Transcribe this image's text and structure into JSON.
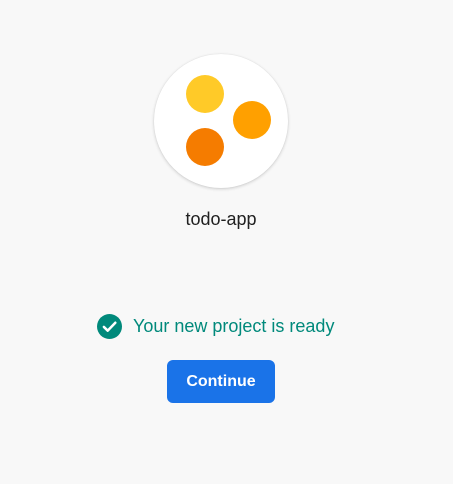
{
  "project": {
    "name": "todo-app",
    "logo_icon": "three-dots-logo-icon",
    "logo_colors": [
      "#ffca28",
      "#ffa000",
      "#f57c00"
    ]
  },
  "status": {
    "icon": "check-circle-icon",
    "text": "Your new project is ready",
    "color": "#00897b"
  },
  "actions": {
    "continue_label": "Continue",
    "accent": "#1a73e8"
  }
}
